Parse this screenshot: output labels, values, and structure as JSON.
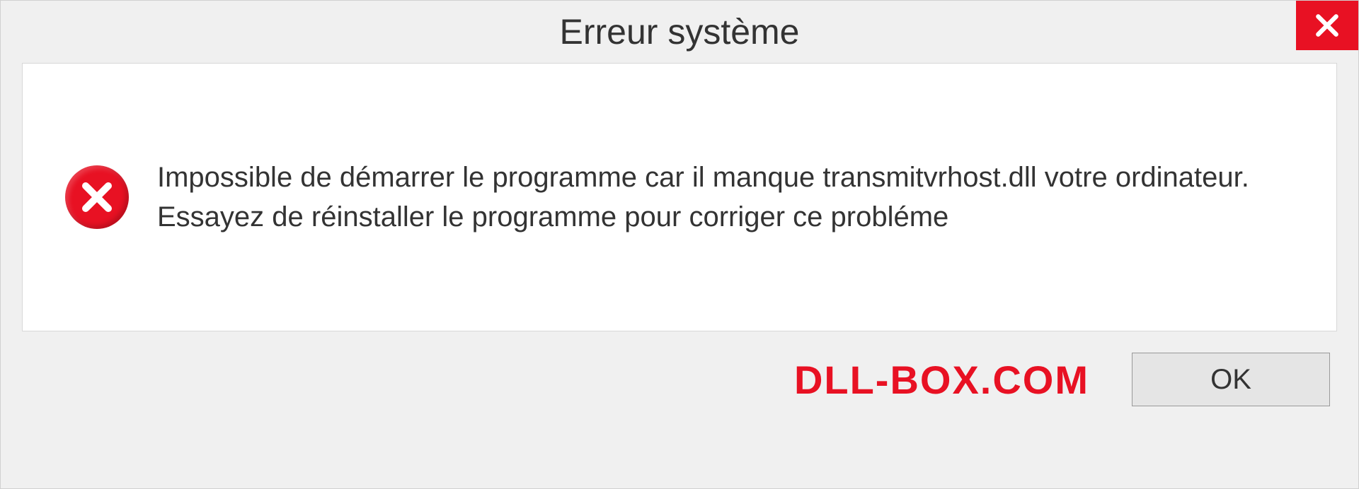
{
  "dialog": {
    "title": "Erreur système",
    "message": "Impossible de démarrer le programme car il manque transmitvrhost.dll votre ordinateur. Essayez de réinstaller le programme pour corriger ce probléme",
    "ok_label": "OK",
    "brand": "DLL-BOX.COM"
  },
  "colors": {
    "error_red": "#e81123",
    "background": "#f0f0f0",
    "panel_bg": "#ffffff"
  }
}
